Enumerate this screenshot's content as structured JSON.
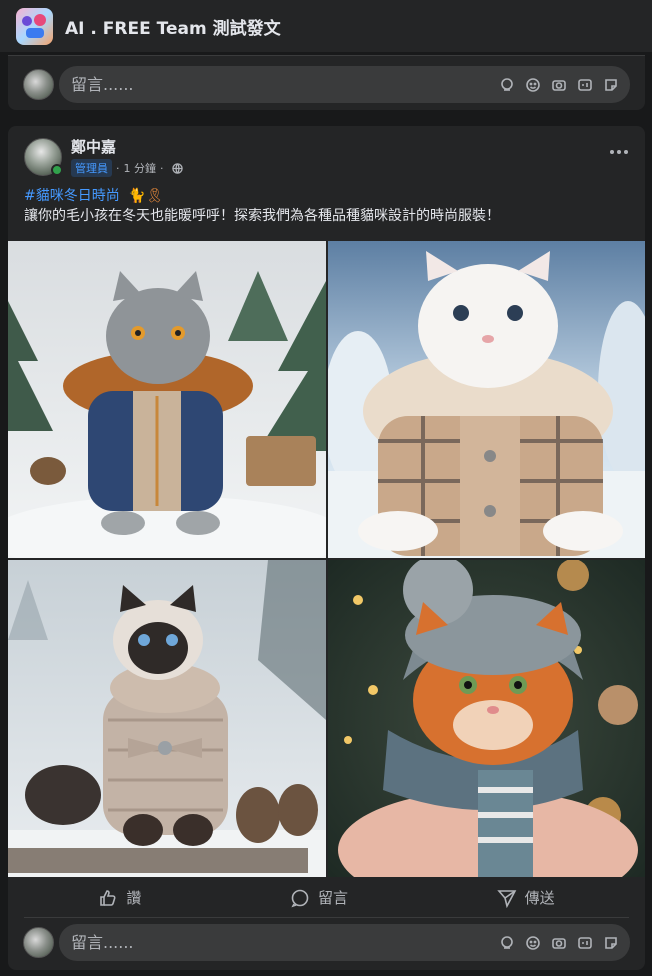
{
  "header": {
    "group_name": "AI . FREE Team 測試發文"
  },
  "top_comment": {
    "placeholder": "留言......"
  },
  "post": {
    "author": "鄭中嘉",
    "role_badge": "管理員",
    "separator": "·",
    "time": "1 分鐘",
    "hashtag": "#貓咪冬日時尚",
    "hashtag_emoji": "🐈🎗",
    "body": "讓你的毛小孩在冬天也能暖呼呼！探索我們為各種品種貓咪設計的時尚服裝！",
    "photos": [
      {
        "icon": "gray-cat-fur-vest"
      },
      {
        "icon": "white-cat-plaid-coat"
      },
      {
        "icon": "siamese-cat-sweater"
      },
      {
        "icon": "orange-cat-beanie-scarf"
      }
    ]
  },
  "actions": {
    "like": "讚",
    "comment": "留言",
    "share": "傳送"
  },
  "bottom_comment": {
    "placeholder": "留言......"
  },
  "colors": {
    "background": "#18191a",
    "card": "#242526",
    "input": "#3a3b3c",
    "link": "#4599ff",
    "online": "#31a24c"
  }
}
